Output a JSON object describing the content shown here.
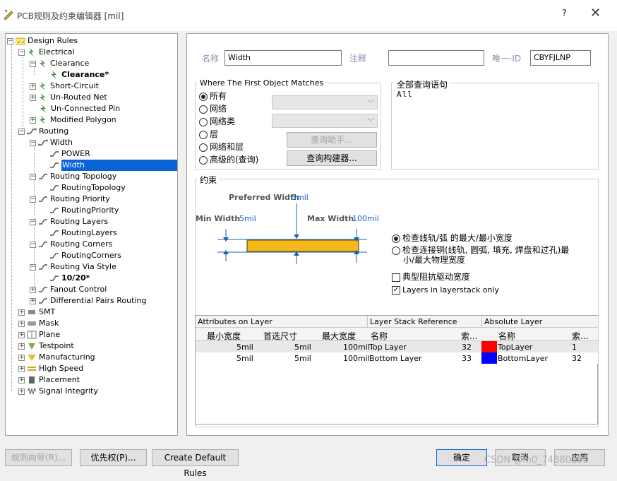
{
  "window": {
    "title": "PCB规则及约束编辑器 [mil]",
    "help_glyph": "?",
    "close_glyph": "✕"
  },
  "tree": {
    "root": "Design Rules",
    "electrical": "Electrical",
    "clearance": "Clearance",
    "clearance_rule": "Clearance*",
    "short_circuit": "Short-Circuit",
    "un_routed_net": "Un-Routed Net",
    "un_connected_pin": "Un-Connected Pin",
    "modified_polygon": "Modified Polygon",
    "routing": "Routing",
    "width": "Width",
    "power": "POWER",
    "width_rule": "Width",
    "routing_topology": "Routing Topology",
    "routing_topology_rule": "RoutingTopology",
    "routing_priority": "Routing Priority",
    "routing_priority_rule": "RoutingPriority",
    "routing_layers": "Routing Layers",
    "routing_layers_rule": "RoutingLayers",
    "routing_corners": "Routing Corners",
    "routing_corners_rule": "RoutingCorners",
    "routing_via_style": "Routing Via Style",
    "via_rule": "10/20*",
    "fanout_control": "Fanout Control",
    "diff_pairs": "Differential Pairs Routing",
    "smt": "SMT",
    "mask": "Mask",
    "plane": "Plane",
    "testpoint": "Testpoint",
    "manufacturing": "Manufacturing",
    "high_speed": "High Speed",
    "placement": "Placement",
    "signal_integrity": "Signal Integrity"
  },
  "header": {
    "name_label": "名称",
    "name_value": "Width",
    "comment_label": "注释",
    "comment_value": "",
    "uid_label": "唯一-ID",
    "uid_value": "CBYFJLNP"
  },
  "match": {
    "group_title": "Where The First Object Matches",
    "options": [
      "所有",
      "网络",
      "网络类",
      "层",
      "网络和层",
      "高级的(查询)"
    ],
    "selected_index": 0,
    "query_helper": "查询助手...",
    "query_builder": "查询构建器..."
  },
  "query": {
    "group_title": "全部查询语句",
    "text": "All"
  },
  "constraints": {
    "group_title": "约束",
    "preferred_label": "Preferred Width",
    "preferred_value": "5mil",
    "min_label": "Min Width",
    "min_value": "5mil",
    "max_label": "Max Width",
    "max_value": "100mil",
    "radio1": "检查线轨/弧 的最大/最小宽度",
    "radio2_line1": "检查连接铜(线轨, 圆弧, 填充, 焊盘和过孔)最",
    "radio2_line2": "小/最大物理宽度",
    "check_impedance": "典型阻抗驱动宽度",
    "check_impedance_checked": false,
    "check_layers": "Layers in layerstack only",
    "check_layers_checked": true,
    "checkmark": "✓"
  },
  "grid": {
    "group1": "Attributes on Layer",
    "group2": "Layer Stack Reference",
    "group3": "Absolute Layer",
    "col_min": "最小宽度",
    "col_pref": "首选尺寸",
    "col_max": "最大宽度",
    "col_name": "名称",
    "col_idx": "索...",
    "col_abs_name": "名称",
    "col_abs_idx": "索...",
    "rows": [
      {
        "min": "5mil",
        "pref": "5mil",
        "max": "100mil",
        "name": "Top Layer",
        "idx": "32",
        "color": "#ff0000",
        "abs_name": "TopLayer",
        "abs_idx": "1"
      },
      {
        "min": "5mil",
        "pref": "5mil",
        "max": "100mil",
        "name": "Bottom Layer",
        "idx": "33",
        "color": "#0000ff",
        "abs_name": "BottomLayer",
        "abs_idx": "32"
      }
    ]
  },
  "footer": {
    "rule_wizard": "规则向导(R)...",
    "priorities": "优先权(P)...",
    "create_default": "Create Default Rules",
    "ok": "确定",
    "cancel": "取消",
    "apply": "应用",
    "watermark": "CSDN @m0_74880180"
  }
}
